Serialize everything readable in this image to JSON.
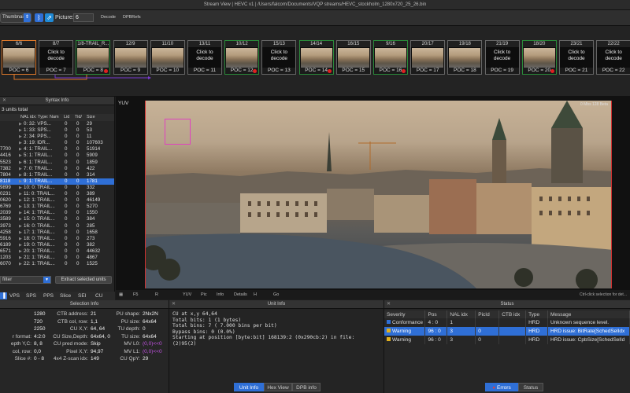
{
  "window": {
    "title": "Stream View  |  HEVC v1  |  /Users/falcom/Documents/VQP streams/HEVC_stockholm_1280x720_25_26.bin"
  },
  "toolbar": {
    "view_select": "Thumbnails",
    "picture_label": "Picture:",
    "picture_value": "6",
    "decode_label": "Decode",
    "dpbrefs_label": "DPBRefs"
  },
  "thumbnails": [
    {
      "label": "6/6",
      "body": "",
      "poc": "POC = 6",
      "selected": true,
      "dot": false
    },
    {
      "label": "8/7",
      "body": "Click to decode",
      "poc": "POC = 7",
      "selected": false,
      "dot": false
    },
    {
      "label": "1/8-TRAIL_R...",
      "body": "",
      "poc": "POC = 8",
      "selected": false,
      "dot": true
    },
    {
      "label": "12/9",
      "body": "",
      "poc": "POC = 9",
      "selected": false,
      "dot": false
    },
    {
      "label": "11/10",
      "body": "",
      "poc": "POC = 10",
      "selected": false,
      "dot": false
    },
    {
      "label": "13/11",
      "body": "Click to decode",
      "poc": "POC = 11",
      "selected": false,
      "dot": false
    },
    {
      "label": "10/12",
      "body": "",
      "poc": "POC = 12",
      "selected": false,
      "dot": true
    },
    {
      "label": "15/13",
      "body": "Click to decode",
      "poc": "POC = 13",
      "selected": false,
      "dot": false
    },
    {
      "label": "14/14",
      "body": "",
      "poc": "POC = 14",
      "selected": false,
      "dot": true
    },
    {
      "label": "16/15",
      "body": "",
      "poc": "POC = 15",
      "selected": false,
      "dot": false
    },
    {
      "label": "9/16",
      "body": "",
      "poc": "POC = 16",
      "selected": false,
      "dot": true
    },
    {
      "label": "20/17",
      "body": "",
      "poc": "POC = 17",
      "selected": false,
      "dot": false
    },
    {
      "label": "19/18",
      "body": "",
      "poc": "POC = 18",
      "selected": false,
      "dot": false
    },
    {
      "label": "21/19",
      "body": "Click to decode",
      "poc": "POC = 19",
      "selected": false,
      "dot": false
    },
    {
      "label": "18/20",
      "body": "",
      "poc": "POC = 20",
      "selected": false,
      "dot": true
    },
    {
      "label": "23/21",
      "body": "Click to decode",
      "poc": "POC = 21",
      "selected": false,
      "dot": false
    },
    {
      "label": "22/22",
      "body": "Click to decode",
      "poc": "POC = 22",
      "selected": false,
      "dot": false
    }
  ],
  "syntax": {
    "title": "Syntax Info",
    "total": "3 units total",
    "headers": {
      "num": "",
      "name": "NAL idx: Type: Nam",
      "lid": "Lid",
      "tid": "Tid/",
      "size": "Size"
    },
    "rows": [
      {
        "num": "",
        "name": "0: 32: VPS...",
        "lid": "0",
        "tid": "0",
        "size": "29",
        "hl": false
      },
      {
        "num": "",
        "name": "1: 33: SPS...",
        "lid": "0",
        "tid": "0",
        "size": "53",
        "hl": false
      },
      {
        "num": "",
        "name": "2: 34: PPS...",
        "lid": "0",
        "tid": "0",
        "size": "11",
        "hl": false
      },
      {
        "num": "",
        "name": "3: 19: IDR...",
        "lid": "0",
        "tid": "0",
        "size": "107603",
        "hl": false
      },
      {
        "num": "7700",
        "name": "4: 1: TRAIL...",
        "lid": "0",
        "tid": "0",
        "size": "51914",
        "hl": false
      },
      {
        "num": "4416",
        "name": "5: 1: TRAIL...",
        "lid": "0",
        "tid": "0",
        "size": "5909",
        "hl": false
      },
      {
        "num": "5523",
        "name": "6: 1: TRAIL...",
        "lid": "0",
        "tid": "0",
        "size": "1859",
        "hl": false
      },
      {
        "num": "7382",
        "name": "7: 0: TRAIL...",
        "lid": "0",
        "tid": "0",
        "size": "422",
        "hl": false
      },
      {
        "num": "7804",
        "name": "8: 1: TRAIL...",
        "lid": "0",
        "tid": "0",
        "size": "314",
        "hl": false
      },
      {
        "num": "8118",
        "name": "9: 1: TRAIL...",
        "lid": "0",
        "tid": "0",
        "size": "1781",
        "hl": true
      },
      {
        "num": "9899",
        "name": "10: 0: TRAIL...",
        "lid": "0",
        "tid": "0",
        "size": "332",
        "hl": false
      },
      {
        "num": "0231",
        "name": "11: 0: TRAIL...",
        "lid": "0",
        "tid": "0",
        "size": "389",
        "hl": false
      },
      {
        "num": "0620",
        "name": "12: 1: TRAIL...",
        "lid": "0",
        "tid": "0",
        "size": "46149",
        "hl": false
      },
      {
        "num": "6769",
        "name": "13: 1: TRAIL...",
        "lid": "0",
        "tid": "0",
        "size": "5270",
        "hl": false
      },
      {
        "num": "2039",
        "name": "14: 1: TRAIL...",
        "lid": "0",
        "tid": "0",
        "size": "1550",
        "hl": false
      },
      {
        "num": "3589",
        "name": "15: 0: TRAIL...",
        "lid": "0",
        "tid": "0",
        "size": "384",
        "hl": false
      },
      {
        "num": "3973",
        "name": "16: 0: TRAIL...",
        "lid": "0",
        "tid": "0",
        "size": "285",
        "hl": false
      },
      {
        "num": "4258",
        "name": "17: 1: TRAIL...",
        "lid": "0",
        "tid": "0",
        "size": "1658",
        "hl": false
      },
      {
        "num": "5916",
        "name": "18: 0: TRAIL...",
        "lid": "0",
        "tid": "0",
        "size": "273",
        "hl": false
      },
      {
        "num": "6189",
        "name": "19: 0: TRAIL...",
        "lid": "0",
        "tid": "0",
        "size": "382",
        "hl": false
      },
      {
        "num": "6571",
        "name": "20: 1: TRAIL...",
        "lid": "0",
        "tid": "0",
        "size": "44632",
        "hl": false
      },
      {
        "num": "1203",
        "name": "21: 1: TRAIL...",
        "lid": "0",
        "tid": "0",
        "size": "4867",
        "hl": false
      },
      {
        "num": "6070",
        "name": "22: 1: TRAIL...",
        "lid": "0",
        "tid": "0",
        "size": "1525",
        "hl": false
      }
    ],
    "filter_placeholder": "filter",
    "extract_label": "Extract selected units"
  },
  "nal_tabs": [
    "VPS",
    "SPS",
    "PPS",
    "Slice",
    "SEI",
    "CU"
  ],
  "video": {
    "label": "YUV",
    "hint": "Ctrl-click selection for det...",
    "tools": [
      "F5",
      "R",
      "YUV",
      "Pic",
      "Info",
      "Details",
      "H",
      "Go"
    ],
    "overlay_top": "0 Mbs 128 Beta"
  },
  "selection_info": {
    "title": "Selection Info",
    "col1": [
      {
        "k": "",
        "v": "1280"
      },
      {
        "k": "",
        "v": "720"
      },
      {
        "k": "",
        "v": "2250"
      },
      {
        "k": "r format:",
        "v": "4:2:0"
      },
      {
        "k": "epth Y,C:",
        "v": "8, 8"
      },
      {
        "k": "col, row:",
        "v": "0,0"
      },
      {
        "k": "Slice #:",
        "v": "0 - 8"
      }
    ],
    "col2": [
      {
        "k": "CTB address:",
        "v": "21"
      },
      {
        "k": "CTB col, row:",
        "v": "1,1"
      },
      {
        "k": "CU X,Y:",
        "v": "64, 64"
      },
      {
        "k": "CU Size,Depth:",
        "v": "64x64, 0"
      },
      {
        "k": "CU pred mode:",
        "v": "Skip"
      },
      {
        "k": "Pixel X,Y:",
        "v": "94,97"
      },
      {
        "k": "4x4 Z-scan idx:",
        "v": "149"
      }
    ],
    "col3": [
      {
        "k": "PU shape:",
        "v": "2Nx2N"
      },
      {
        "k": "PU size:",
        "v": "64x64"
      },
      {
        "k": "TU depth:",
        "v": "0"
      },
      {
        "k": "TU size:",
        "v": "64x64"
      },
      {
        "k": "MV L0:",
        "v": "(0,0)<<0"
      },
      {
        "k": "MV L1:",
        "v": "(0,0)<<0"
      },
      {
        "k": "CU QpY:",
        "v": "29"
      }
    ]
  },
  "unit_info": {
    "title": "Unit Info",
    "text": "CU at x,y 64,64\nTotal bits: 1 (1 bytes)\nTotal bins: 7 ( 7.000 bins per bit)\nBypass bins: 0 (0.0%)\nStarting at position [byte:bit] 168139:2 (0x290cb:2) in file:\n(2)95(2)",
    "tabs": [
      "Unit Info",
      "Hex View",
      "DPB info"
    ]
  },
  "status": {
    "title": "Status",
    "columns": [
      "Severity",
      "Pos",
      "NAL idx",
      "PicId",
      "CTB idx",
      "Type",
      "Message"
    ],
    "rows": [
      {
        "sev": "Conformance",
        "pos": "4 : 0",
        "nal": "1",
        "pic": "",
        "ctb": "",
        "type": "HRD",
        "msg": "Unknown sequence level.",
        "sel": false,
        "kind": "conf"
      },
      {
        "sev": "Warning",
        "pos": "96 : 0",
        "nal": "3",
        "pic": "0",
        "ctb": "",
        "type": "HRD",
        "msg": "HRD issue: BitRate[SchedSelIdx",
        "sel": true,
        "kind": "warn"
      },
      {
        "sev": "Warning",
        "pos": "96 : 0",
        "nal": "3",
        "pic": "0",
        "ctb": "",
        "type": "HRD",
        "msg": "HRD issue: CpbSize[SchedSelId",
        "sel": false,
        "kind": "warn"
      }
    ],
    "tabs": [
      "Errors",
      "Status"
    ]
  }
}
